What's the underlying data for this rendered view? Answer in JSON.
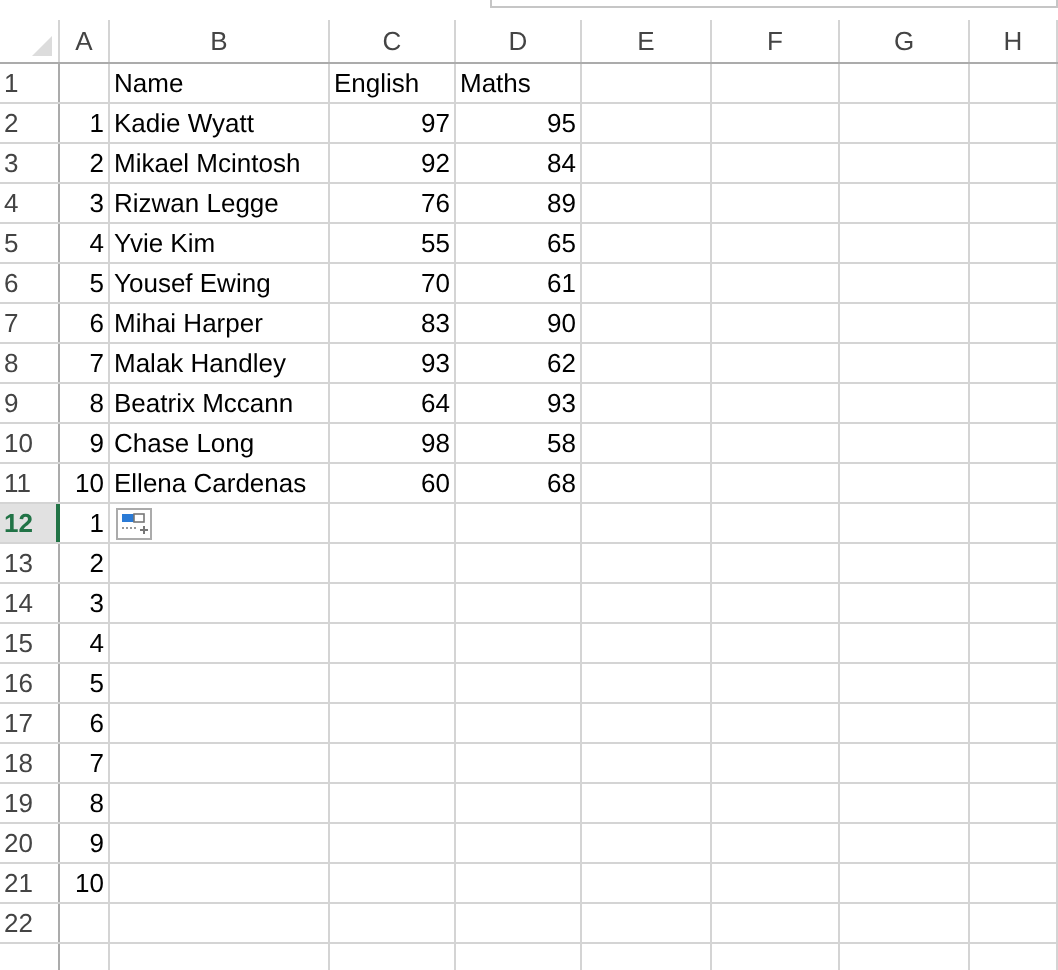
{
  "columns": [
    {
      "label": "A",
      "kind": "number"
    },
    {
      "label": "B",
      "kind": "text"
    },
    {
      "label": "C",
      "kind": "number"
    },
    {
      "label": "D",
      "kind": "number"
    },
    {
      "label": "E",
      "kind": "text"
    },
    {
      "label": "F",
      "kind": "text"
    },
    {
      "label": "G",
      "kind": "text"
    },
    {
      "label": "H",
      "kind": "text"
    }
  ],
  "rows": [
    {
      "number": "1",
      "kind": "header",
      "selected": false,
      "paste_options": false,
      "cells": [
        "",
        "Name",
        "English",
        "Maths"
      ]
    },
    {
      "number": "2",
      "kind": "data",
      "selected": false,
      "paste_options": false,
      "cells": [
        "1",
        "Kadie Wyatt",
        "97",
        "95"
      ]
    },
    {
      "number": "3",
      "kind": "data",
      "selected": false,
      "paste_options": false,
      "cells": [
        "2",
        "Mikael Mcintosh",
        "92",
        "84"
      ]
    },
    {
      "number": "4",
      "kind": "data",
      "selected": false,
      "paste_options": false,
      "cells": [
        "3",
        "Rizwan Legge",
        "76",
        "89"
      ]
    },
    {
      "number": "5",
      "kind": "data",
      "selected": false,
      "paste_options": false,
      "cells": [
        "4",
        "Yvie Kim",
        "55",
        "65"
      ]
    },
    {
      "number": "6",
      "kind": "data",
      "selected": false,
      "paste_options": false,
      "cells": [
        "5",
        "Yousef Ewing",
        "70",
        "61"
      ]
    },
    {
      "number": "7",
      "kind": "data",
      "selected": false,
      "paste_options": false,
      "cells": [
        "6",
        "Mihai Harper",
        "83",
        "90"
      ]
    },
    {
      "number": "8",
      "kind": "data",
      "selected": false,
      "paste_options": false,
      "cells": [
        "7",
        "Malak Handley",
        "93",
        "62"
      ]
    },
    {
      "number": "9",
      "kind": "data",
      "selected": false,
      "paste_options": false,
      "cells": [
        "8",
        "Beatrix Mccann",
        "64",
        "93"
      ]
    },
    {
      "number": "10",
      "kind": "data",
      "selected": false,
      "paste_options": false,
      "cells": [
        "9",
        "Chase Long",
        "98",
        "58"
      ]
    },
    {
      "number": "11",
      "kind": "data",
      "selected": false,
      "paste_options": false,
      "cells": [
        "10",
        "Ellena Cardenas",
        "60",
        "68"
      ]
    },
    {
      "number": "12",
      "kind": "data",
      "selected": true,
      "paste_options": true,
      "cells": [
        "1"
      ]
    },
    {
      "number": "13",
      "kind": "data",
      "selected": false,
      "paste_options": false,
      "cells": [
        "2"
      ]
    },
    {
      "number": "14",
      "kind": "data",
      "selected": false,
      "paste_options": false,
      "cells": [
        "3"
      ]
    },
    {
      "number": "15",
      "kind": "data",
      "selected": false,
      "paste_options": false,
      "cells": [
        "4"
      ]
    },
    {
      "number": "16",
      "kind": "data",
      "selected": false,
      "paste_options": false,
      "cells": [
        "5"
      ]
    },
    {
      "number": "17",
      "kind": "data",
      "selected": false,
      "paste_options": false,
      "cells": [
        "6"
      ]
    },
    {
      "number": "18",
      "kind": "data",
      "selected": false,
      "paste_options": false,
      "cells": [
        "7"
      ]
    },
    {
      "number": "19",
      "kind": "data",
      "selected": false,
      "paste_options": false,
      "cells": [
        "8"
      ]
    },
    {
      "number": "20",
      "kind": "data",
      "selected": false,
      "paste_options": false,
      "cells": [
        "9"
      ]
    },
    {
      "number": "21",
      "kind": "data",
      "selected": false,
      "paste_options": false,
      "cells": [
        "10"
      ]
    },
    {
      "number": "22",
      "kind": "data",
      "selected": false,
      "paste_options": false,
      "cells": []
    }
  ]
}
